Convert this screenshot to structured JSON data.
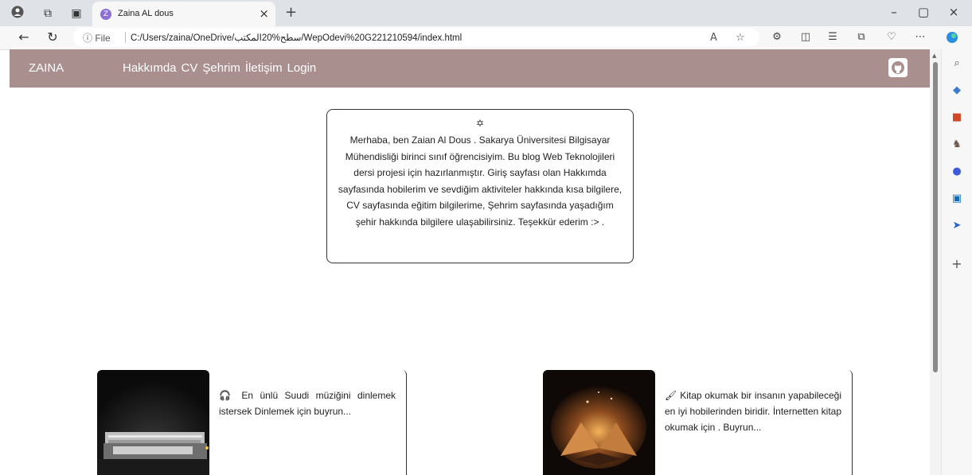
{
  "browser": {
    "tab_title": "Zaina AL dous",
    "tab_favicon": "Z",
    "close_tab": "×",
    "new_tab": "+",
    "info_label": "ⓘ File",
    "url": "C:/Users/zaina/OneDrive/سطح%20المكتب/WepOdevi%20G221210594/index.html",
    "window_controls": {
      "minimize": "–",
      "restore": "▢",
      "close": "×"
    }
  },
  "site": {
    "brand": "ZAINA",
    "nav": [
      "Hakkımda",
      "CV",
      "Şehrim",
      "İletişim",
      "Login"
    ],
    "github_icon": "github-icon",
    "intro_symbol": "✡",
    "intro_text": "Merhaba, ben Zaian Al Dous . Sakarya Üniversitesi Bilgisayar Mühendisliği birinci sınıf öğrencisiyim. Bu blog Web Teknolojileri dersi projesi için hazırlanmıştır. Giriş sayfası olan Hakkımda sayfasında hobilerim ve sevdiğim aktiviteler hakkında kısa bilgilere, CV sayfasında eğitim bilgilerime, Şehrim sayfasında yaşadığım şehir hakkında bilgilere ulaşabilirsiniz. Teşekkür ederim :> .",
    "cards": [
      {
        "icon": "🎧",
        "text": "En ünlü Suudi müziğini dinlemek istersek Dinlemek için buyrun..."
      },
      {
        "icon": "🖌",
        "text": "Kitap okumak bir insanın yapabileceği en iyi hobilerinden biridir. İnternetten kitap okumak için . Buyrun..."
      }
    ]
  },
  "colors": {
    "navbar": "#a98f8e",
    "tabbar": "#dfe3e7"
  }
}
